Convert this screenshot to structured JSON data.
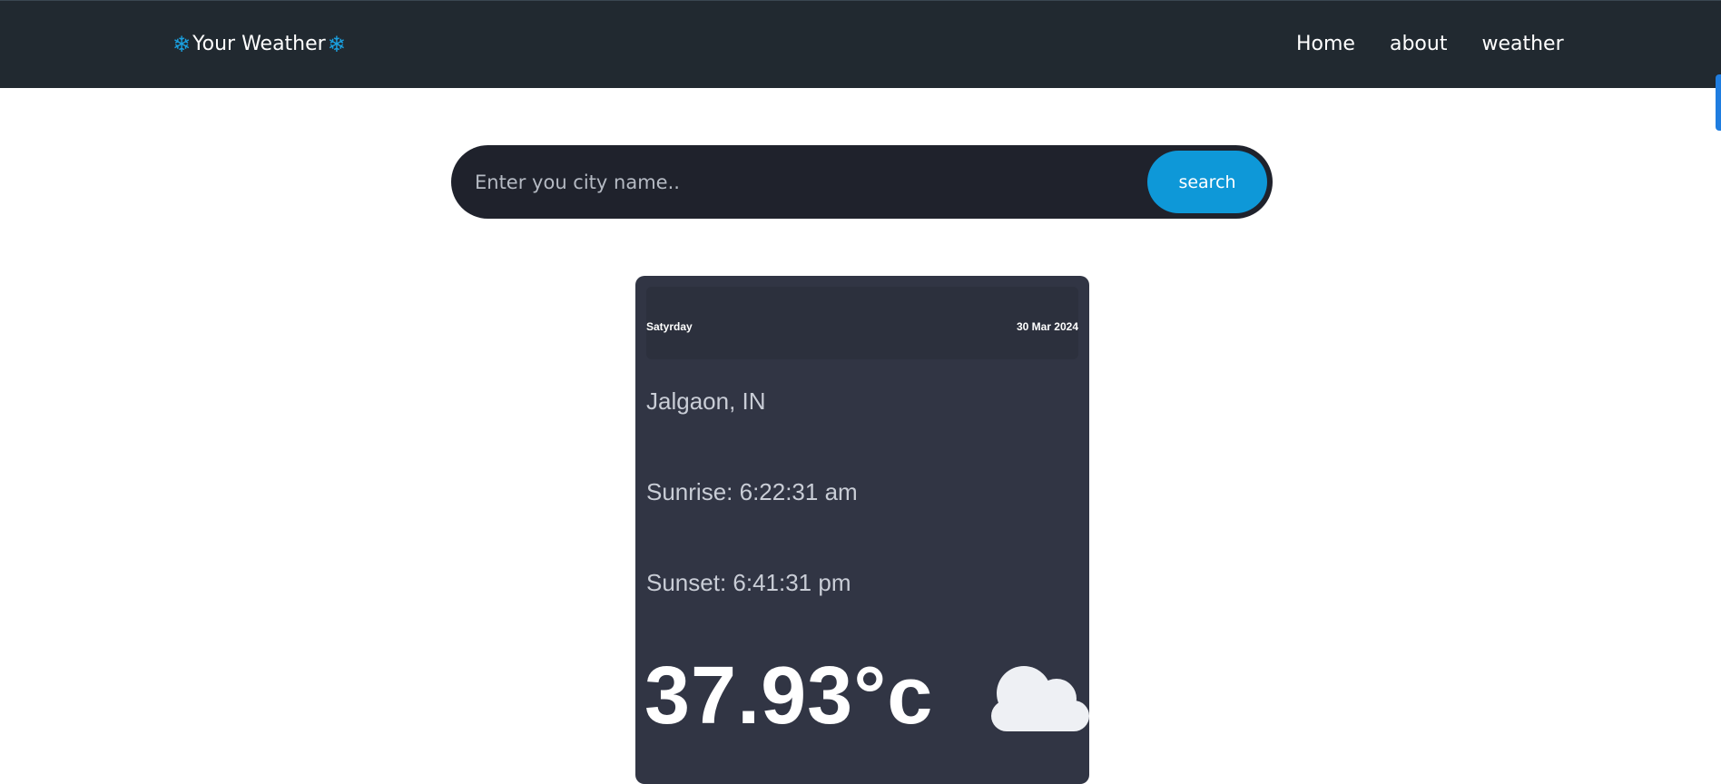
{
  "navbar": {
    "brand": {
      "icon": "snowflake-icon",
      "title": "Your Weather"
    },
    "links": [
      {
        "label": "Home"
      },
      {
        "label": "about"
      },
      {
        "label": "weather"
      }
    ]
  },
  "search": {
    "placeholder": "Enter you city name..",
    "value": "",
    "button_label": "search"
  },
  "card": {
    "day": "Satyrday",
    "date": "30 Mar 2024",
    "city": "Jalgaon, IN",
    "sunrise": "Sunrise: 6:22:31 am",
    "sunset": "Sunset: 6:41:31 pm",
    "temperature": "37.93°c",
    "weather_icon": "cloud-icon"
  },
  "colors": {
    "navbar_bg": "#212930",
    "accent": "#0e98d8",
    "search_bg": "#1f222c",
    "card_bg": "#313544"
  }
}
